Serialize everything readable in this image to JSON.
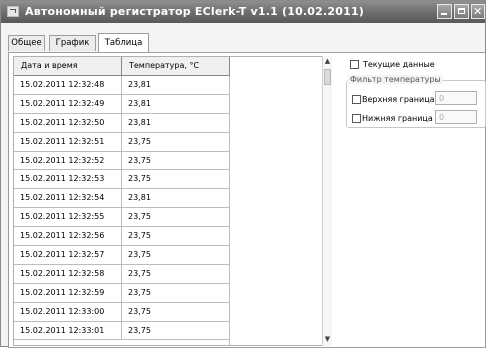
{
  "window": {
    "title": "Автономный регистратор EClerk-T v1.1 (10.02.2011)"
  },
  "tabs": [
    {
      "label": "Общее"
    },
    {
      "label": "График"
    },
    {
      "label": "Таблица"
    }
  ],
  "table": {
    "columns": [
      "Дата и время",
      "Температура, °С"
    ],
    "rows": [
      [
        "15.02.2011 12:32:48",
        "23,81"
      ],
      [
        "15.02.2011 12:32:49",
        "23,81"
      ],
      [
        "15.02.2011 12:32:50",
        "23,81"
      ],
      [
        "15.02.2011 12:32:51",
        "23,75"
      ],
      [
        "15.02.2011 12:32:52",
        "23,75"
      ],
      [
        "15.02.2011 12:32:53",
        "23,75"
      ],
      [
        "15.02.2011 12:32:54",
        "23,81"
      ],
      [
        "15.02.2011 12:32:55",
        "23,75"
      ],
      [
        "15.02.2011 12:32:56",
        "23,75"
      ],
      [
        "15.02.2011 12:32:57",
        "23,75"
      ],
      [
        "15.02.2011 12:32:58",
        "23,75"
      ],
      [
        "15.02.2011 12:32:59",
        "23,75"
      ],
      [
        "15.02.2011 12:33:00",
        "23,75"
      ],
      [
        "15.02.2011 12:33:01",
        "23,75"
      ]
    ]
  },
  "options": {
    "current_data_label": "Текущие данные",
    "filter_group_label": "Фильтр температуры",
    "upper_label": "Верхняя граница",
    "lower_label": "Нижняя граница",
    "upper_value": "0",
    "lower_value": "0"
  }
}
